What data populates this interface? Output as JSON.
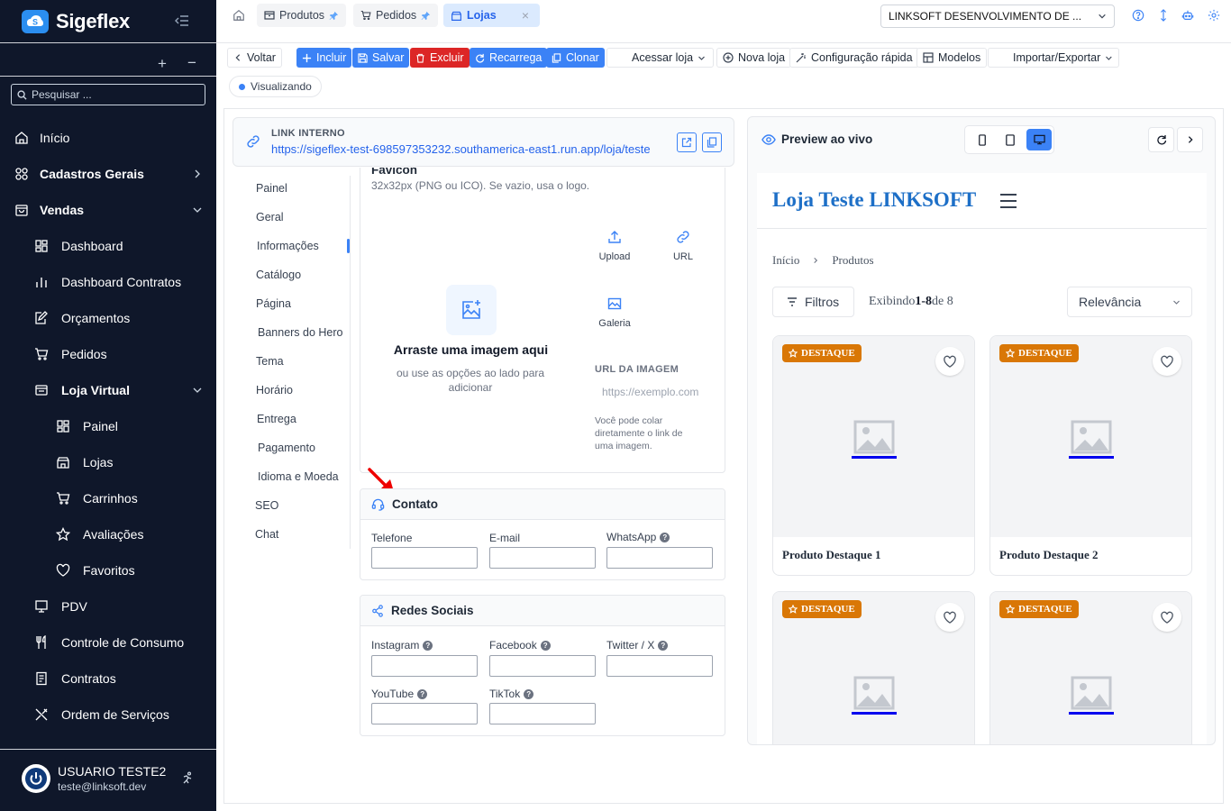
{
  "sidebar": {
    "brand": "Sigeflex",
    "search_placeholder": "Pesquisar ...",
    "items": [
      {
        "label": "Início",
        "icon": "home-icon"
      },
      {
        "label": "Cadastros Gerais",
        "icon": "grid-icon"
      },
      {
        "label": "Vendas",
        "icon": "shopping-bag-icon"
      },
      {
        "label": "Dashboard",
        "icon": "dashboard-icon"
      },
      {
        "label": "Dashboard Contratos",
        "icon": "bar-chart-icon"
      },
      {
        "label": "Orçamentos",
        "icon": "edit-document-icon"
      },
      {
        "label": "Pedidos",
        "icon": "cart-icon"
      },
      {
        "label": "Loja Virtual",
        "icon": "store-card-icon"
      },
      {
        "label": "Painel",
        "icon": "dashboard-icon"
      },
      {
        "label": "Lojas",
        "icon": "store-icon"
      },
      {
        "label": "Carrinhos",
        "icon": "cart-icon"
      },
      {
        "label": "Avaliações",
        "icon": "star-icon"
      },
      {
        "label": "Favoritos",
        "icon": "heart-icon"
      },
      {
        "label": "PDV",
        "icon": "monitor-icon"
      },
      {
        "label": "Controle de Consumo",
        "icon": "utensils-icon"
      },
      {
        "label": "Contratos",
        "icon": "document-icon"
      },
      {
        "label": "Ordem de Serviços",
        "icon": "tools-icon"
      }
    ],
    "user_name": "USUARIO TESTE2",
    "user_email": "teste@linksoft.dev"
  },
  "tabs": [
    {
      "label": "Produtos"
    },
    {
      "label": "Pedidos"
    },
    {
      "label": "Lojas"
    }
  ],
  "company": "LINKSOFT DESENVOLVIMENTO DE ...",
  "toolbar": {
    "voltar": "Voltar",
    "incluir": "Incluir",
    "salvar": "Salvar",
    "excluir": "Excluir",
    "recarrega": "Recarrega",
    "clonar": "Clonar",
    "acessar_loja": "Acessar loja",
    "nova_loja": "Nova loja",
    "config_rapida": "Configuração rápida",
    "modelos": "Modelos",
    "importar": "Importar/Exportar",
    "status": "Visualizando"
  },
  "link": {
    "label": "LINK INTERNO",
    "url": "https://sigeflex-test-698597353232.southamerica-east1.run.app/loja/teste"
  },
  "subnav": [
    "Painel",
    "Geral",
    "Informações",
    "Catálogo",
    "Página",
    "Banners do Hero",
    "Tema",
    "Horário",
    "Entrega",
    "Pagamento",
    "Idioma e Moeda",
    "SEO",
    "Chat"
  ],
  "favicon": {
    "title": "Favicon",
    "hint": "32x32px (PNG ou ICO). Se vazio, usa o logo.",
    "drop_title": "Arraste uma imagem aqui",
    "drop_sub": "ou use as opções ao lado para adicionar",
    "upload": "Upload",
    "url": "URL",
    "galeria": "Galeria",
    "url_label": "URL DA IMAGEM",
    "url_placeholder": "https://exemplo.com",
    "url_help": "Você pode colar diretamente o link de uma imagem."
  },
  "contato": {
    "title": "Contato",
    "telefone": "Telefone",
    "email": "E-mail",
    "whatsapp": "WhatsApp"
  },
  "redes": {
    "title": "Redes Sociais",
    "instagram": "Instagram",
    "facebook": "Facebook",
    "twitter": "Twitter / X",
    "youtube": "YouTube",
    "tiktok": "TikTok"
  },
  "preview": {
    "title": "Preview ao vivo",
    "store_name": "Loja Teste LINKSOFT",
    "breadcrumb_home": "Início",
    "breadcrumb_current": "Produtos",
    "filtros": "Filtros",
    "showing_prefix": "Exibindo",
    "showing_range": "1-8",
    "showing_suffix": "de 8",
    "sort": "Relevância",
    "badge": "DESTAQUE",
    "products": [
      "Produto Destaque 1",
      "Produto Destaque 2"
    ]
  },
  "colors": {
    "sidebar_bg": "#0f172a",
    "accent": "#3b82f6",
    "danger": "#dc2626",
    "badge": "#d97706",
    "store_title": "#1d6fc7"
  }
}
